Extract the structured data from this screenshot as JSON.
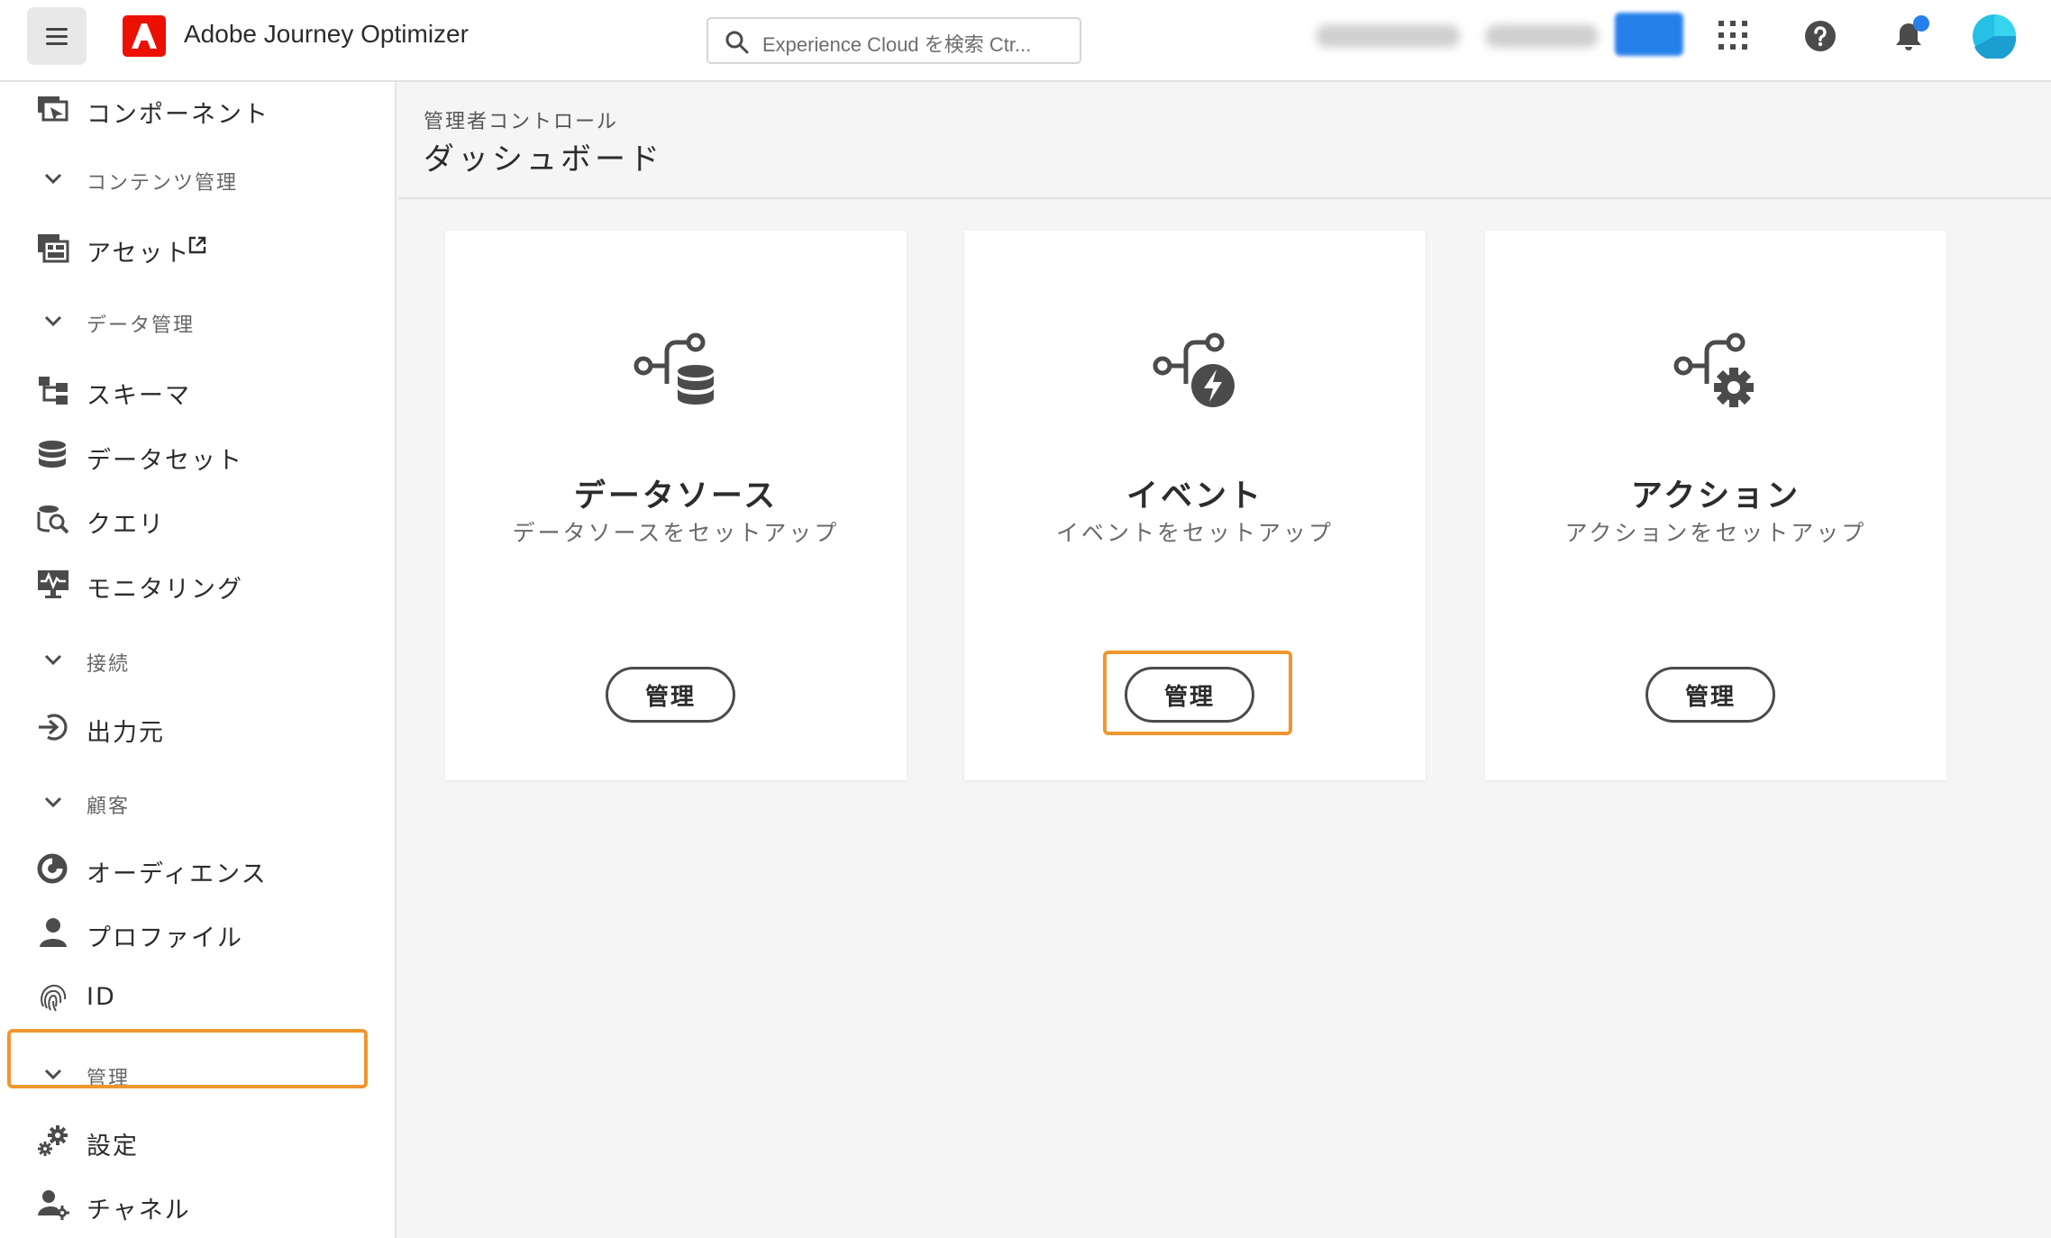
{
  "header": {
    "app_title": "Adobe Journey Optimizer",
    "search_placeholder": "Experience Cloud を検索 Ctr..."
  },
  "sidebar": {
    "items": [
      {
        "type": "item",
        "label": "コンポーネント",
        "icon": "components-icon"
      },
      {
        "type": "section",
        "label": "コンテンツ管理"
      },
      {
        "type": "item",
        "label": "アセット",
        "icon": "assets-icon",
        "external": true
      },
      {
        "type": "section",
        "label": "データ管理"
      },
      {
        "type": "item",
        "label": "スキーマ",
        "icon": "schema-icon"
      },
      {
        "type": "item",
        "label": "データセット",
        "icon": "dataset-icon"
      },
      {
        "type": "item",
        "label": "クエリ",
        "icon": "query-icon"
      },
      {
        "type": "item",
        "label": "モニタリング",
        "icon": "monitoring-icon"
      },
      {
        "type": "section",
        "label": "接続"
      },
      {
        "type": "item",
        "label": "出力元",
        "icon": "sources-icon"
      },
      {
        "type": "section",
        "label": "顧客"
      },
      {
        "type": "item",
        "label": "オーディエンス",
        "icon": "audience-icon"
      },
      {
        "type": "item",
        "label": "プロファイル",
        "icon": "profile-icon"
      },
      {
        "type": "item",
        "label": "ID",
        "icon": "identity-fingerprint-icon"
      },
      {
        "type": "section",
        "label": "管理"
      },
      {
        "type": "item",
        "label": "設定",
        "icon": "settings-gear-icon",
        "highlighted": true
      },
      {
        "type": "item",
        "label": "チャネル",
        "icon": "channel-icon"
      }
    ]
  },
  "main": {
    "breadcrumb": "管理者コントロール",
    "title": "ダッシュボード",
    "cards": [
      {
        "title": "データソース",
        "subtitle": "データソースをセットアップ",
        "button": "管理",
        "icon": "datasource-icon"
      },
      {
        "title": "イベント",
        "subtitle": "イベントをセットアップ",
        "button": "管理",
        "icon": "event-icon",
        "highlighted": true
      },
      {
        "title": "アクション",
        "subtitle": "アクションをセットアップ",
        "button": "管理",
        "icon": "action-icon"
      }
    ]
  },
  "colors": {
    "highlight": "#f0962f",
    "adobe_red": "#eb1000",
    "notification": "#2680eb"
  }
}
